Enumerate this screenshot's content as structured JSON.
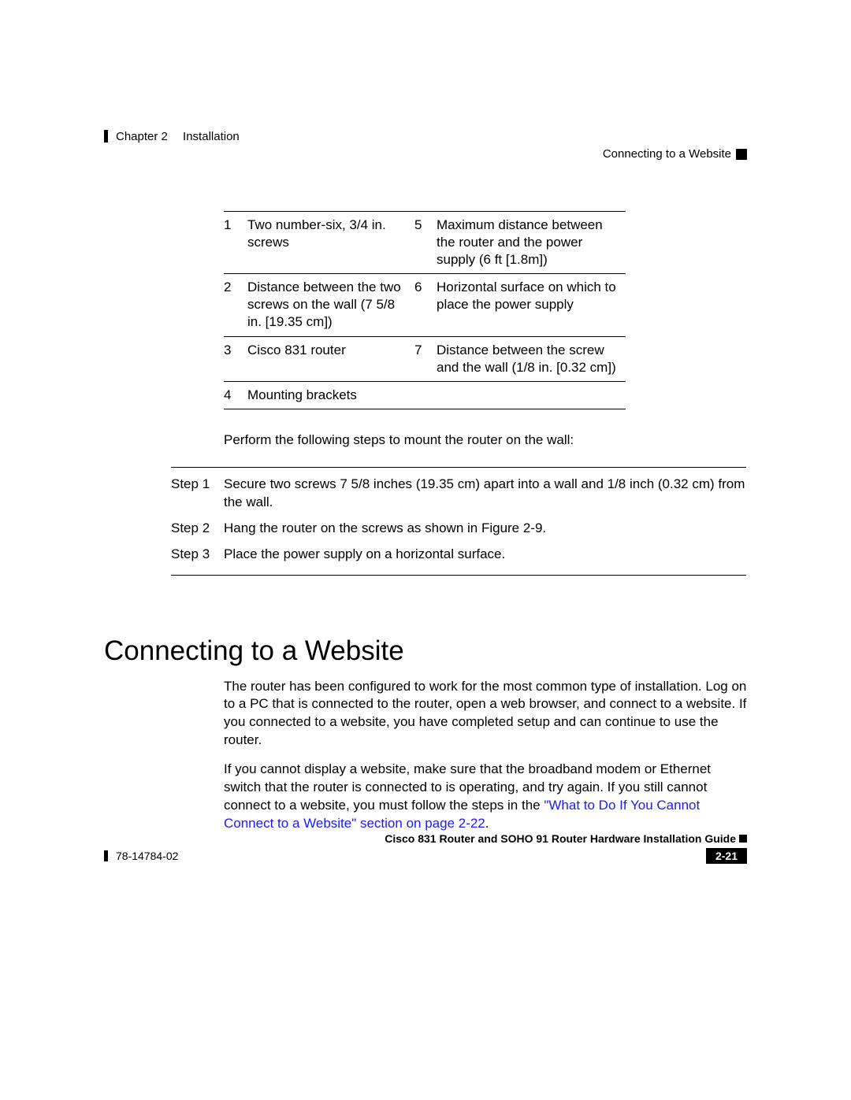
{
  "header": {
    "chapter": "Chapter 2",
    "chapter_title": "Installation",
    "section_right": "Connecting to a Website"
  },
  "table": {
    "rows": [
      {
        "n1": "1",
        "t1": "Two number-six, 3/4 in. screws",
        "n2": "5",
        "t2": "Maximum distance between the router and the power supply (6 ft [1.8m])"
      },
      {
        "n1": "2",
        "t1": "Distance between the two screws on the wall (7 5/8 in. [19.35 cm])",
        "n2": "6",
        "t2": "Horizontal surface on which to place the power supply"
      },
      {
        "n1": "3",
        "t1": "Cisco 831 router",
        "n2": "7",
        "t2": "Distance between the screw and the wall (1/8 in. [0.32 cm])"
      },
      {
        "n1": "4",
        "t1": "Mounting brackets",
        "n2": "",
        "t2": ""
      }
    ]
  },
  "intro_para": "Perform the following steps to mount the router on the wall:",
  "steps": [
    {
      "label": "Step 1",
      "text": "Secure two screws 7 5/8 inches (19.35 cm) apart into a wall and 1/8 inch (0.32 cm) from the wall."
    },
    {
      "label": "Step 2",
      "text": "Hang the router on the screws as shown in Figure 2-9."
    },
    {
      "label": "Step 3",
      "text": "Place the power supply on a horizontal surface."
    }
  ],
  "section_heading": "Connecting to a Website",
  "body_para1": "The router has been configured to work for the most common type of installation. Log on to a PC that is connected to the router, open a web browser, and connect to a website. If you connected to a website, you have completed setup and can continue to use the router.",
  "body_para2_pre": "If you cannot display a website, make sure that the broadband modem or Ethernet switch that the router is connected to is operating, and try again. If you still cannot connect to a website, you must follow the steps in the ",
  "body_para2_link": "\"What to Do If You Cannot Connect to a Website\" section on page 2-22",
  "body_para2_post": ".",
  "footer": {
    "title": "Cisco 831 Router and SOHO 91 Router Hardware Installation Guide",
    "doc_num": "78-14784-02",
    "page": "2-21"
  }
}
